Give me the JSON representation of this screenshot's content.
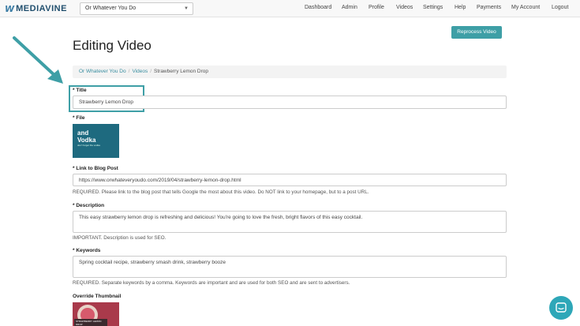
{
  "brand": {
    "mark": "W",
    "name": "MEDIAVINE"
  },
  "site_select": {
    "value": "Or Whatever You Do"
  },
  "nav": [
    "Dashboard",
    "Admin",
    "Profile",
    "Videos",
    "Settings",
    "Help",
    "Payments",
    "My Account",
    "Logout"
  ],
  "header": {
    "title": "Editing Video",
    "reprocess_label": "Reprocess Video"
  },
  "breadcrumb": {
    "items": [
      "Or Whatever You Do",
      "Videos",
      "Strawberry Lemon Drop"
    ]
  },
  "form": {
    "required_mark": "*",
    "title": {
      "label": "Title",
      "value": "Strawberry Lemon Drop"
    },
    "file": {
      "label": "File",
      "thumb_line1": "and",
      "thumb_line2": "Vodka",
      "thumb_small": "don't forget the vodka"
    },
    "link": {
      "label": "Link to Blog Post",
      "value": "https://www.orwhateveryoudo.com/2019/04/strawberry-lemon-drop.html",
      "help": "REQUIRED. Please link to the blog post that tells Google the most about this video. Do NOT link to your homepage, but to a post URL."
    },
    "description": {
      "label": "Description",
      "value": "This easy strawberry lemon drop is refreshing and delicious! You're going to love the fresh, bright flavors of this easy cocktail.",
      "help": "IMPORTANT. Description is used for SEO."
    },
    "keywords": {
      "label": "Keywords",
      "value": "Spring cocktail recipe, strawberry smash drink, strawberry booze",
      "help": "REQUIRED. Separate keywords by a comma. Keywords are important and are used for both SEO and are sent to advertisers."
    },
    "override_thumbnail": {
      "label": "Override Thumbnail",
      "thumb_text": "STRAWBERRY LEMON DROP"
    }
  },
  "colors": {
    "accent": "#3e9fa6",
    "arrow": "#3e9fa6",
    "chat": "#2ea7b8"
  },
  "icons": {
    "chat": "chat-bubble-icon",
    "dropdown": "chevron-down-icon",
    "annotation": "arrow-icon"
  }
}
